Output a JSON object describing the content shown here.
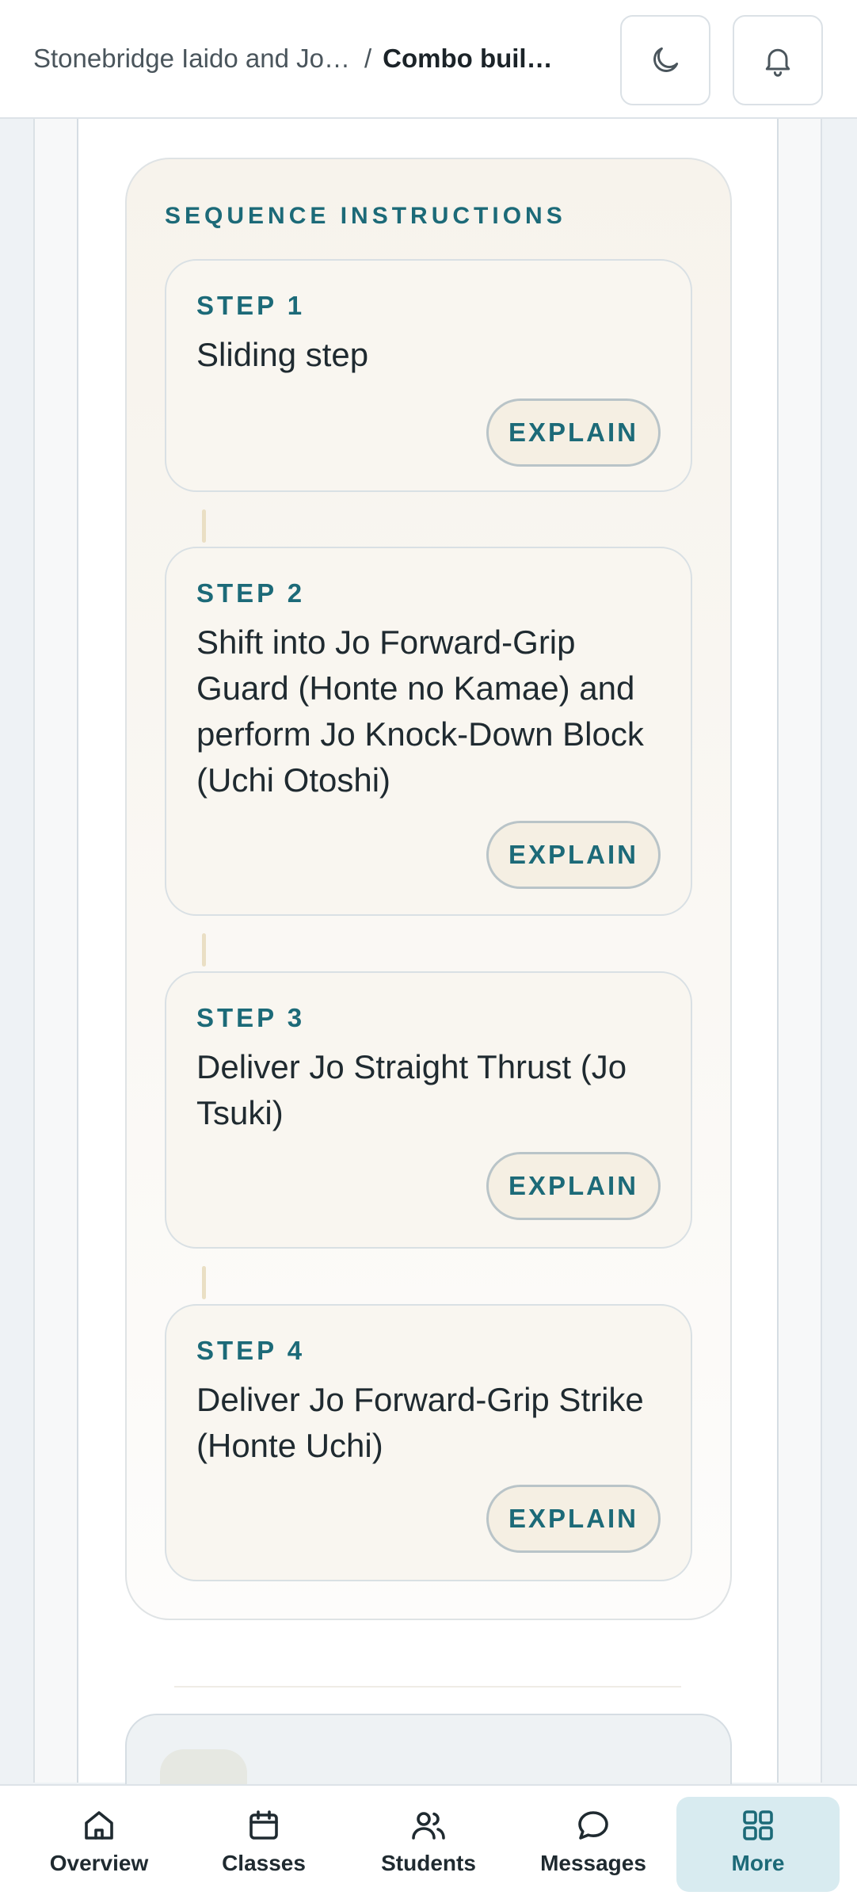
{
  "header": {
    "breadcrumb_root": "Stonebridge Iaido and Jo…",
    "breadcrumb_separator": "/",
    "breadcrumb_current": "Combo build…"
  },
  "sequence": {
    "title": "SEQUENCE INSTRUCTIONS",
    "steps": [
      {
        "label": "STEP 1",
        "text": "Sliding step",
        "button": "EXPLAIN"
      },
      {
        "label": "STEP 2",
        "text": "Shift into Jo Forward-Grip Guard (Honte no Kamae) and perform Jo Knock-Down Block (Uchi Otoshi)",
        "button": "EXPLAIN"
      },
      {
        "label": "STEP 3",
        "text": "Deliver Jo Straight Thrust (Jo Tsuki)",
        "button": "EXPLAIN"
      },
      {
        "label": "STEP 4",
        "text": "Deliver Jo Forward-Grip Strike (Honte Uchi)",
        "button": "EXPLAIN"
      }
    ]
  },
  "nav": {
    "items": [
      {
        "label": "Overview",
        "icon": "home-icon"
      },
      {
        "label": "Classes",
        "icon": "calendar-icon"
      },
      {
        "label": "Students",
        "icon": "users-icon"
      },
      {
        "label": "Messages",
        "icon": "chat-icon"
      },
      {
        "label": "More",
        "icon": "grid-icon",
        "active": true
      }
    ]
  },
  "colors": {
    "accent": "#1c6a78",
    "active_nav_bg": "#d8ebf0",
    "card_bg": "#f9f6f0"
  }
}
